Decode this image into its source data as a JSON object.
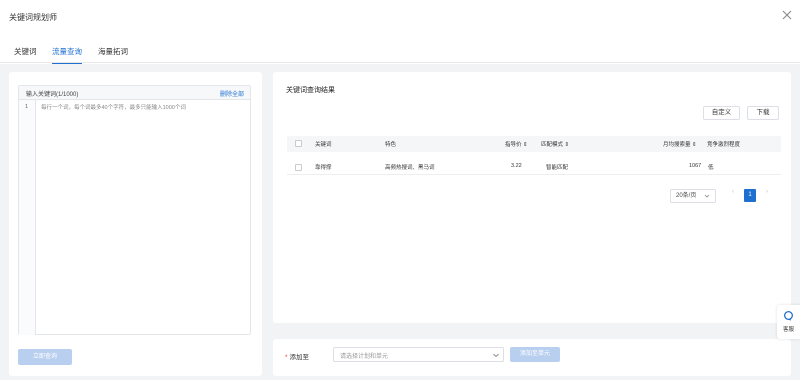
{
  "dialog": {
    "title": "关键词规划师"
  },
  "tabs": [
    {
      "label": "关键词",
      "active": false
    },
    {
      "label": "流量查询",
      "active": true
    },
    {
      "label": "海量拓词",
      "active": false
    }
  ],
  "input_panel": {
    "header_label": "输入关键词(1/1000)",
    "delete_all": "删除全部",
    "line_number": "1",
    "placeholder": "每行一个词，每个词最多40个字符，最多只能输入1000个词",
    "query_button": "立即查询"
  },
  "results": {
    "title": "关键词查询结果",
    "customize_button": "自定义",
    "download_button": "下载",
    "columns": {
      "keyword": "关键词",
      "feature": "特色",
      "price": "指导价 ⇕",
      "match": "匹配模式 ⇕",
      "search_volume": "月均搜索量 ⇕",
      "competition": "竞争激烈程度"
    },
    "rows": [
      {
        "keyword": "靠得撑",
        "feature": "高频热搜词、黑马词",
        "price": "3.22",
        "match": "智能匹配",
        "search_volume": "1067",
        "competition": "低"
      }
    ],
    "pagination": {
      "page_size": "20条/页",
      "prev": "‹",
      "current_page": "1",
      "next": "›"
    }
  },
  "add_bar": {
    "required_mark": "*",
    "label": "添加至",
    "select_placeholder": "请选择计划和单元",
    "confirm_button": "添加至单元"
  },
  "float_widget": {
    "label": "客服"
  },
  "colors": {
    "accent": "#1f6fd1",
    "disabled_button": "#b9cff0",
    "background": "#f2f3f5",
    "required": "#e54545"
  }
}
